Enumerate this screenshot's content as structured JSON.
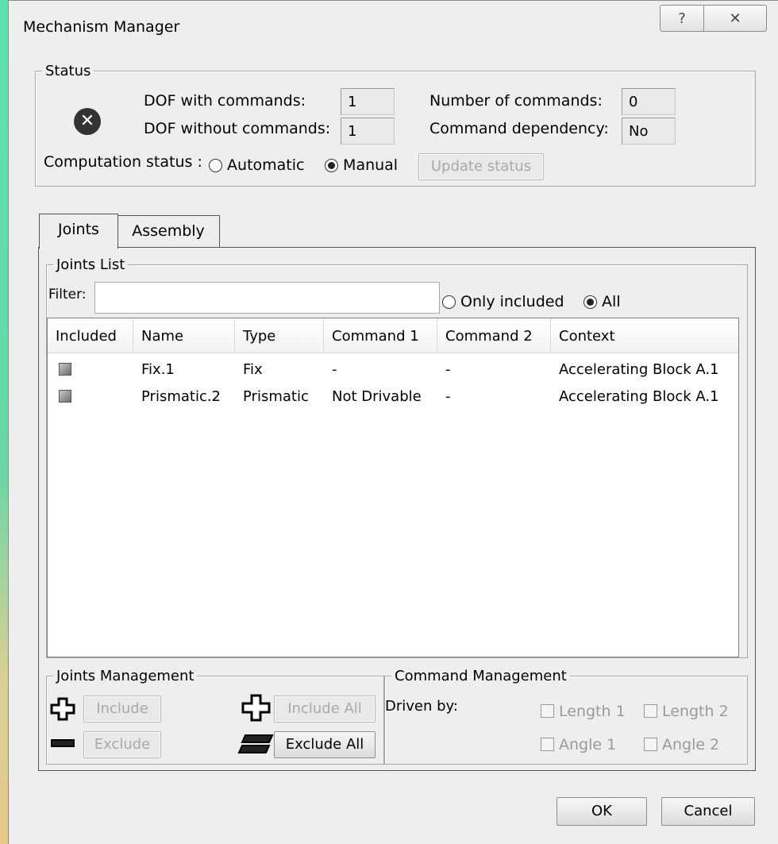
{
  "window": {
    "title": "Mechanism Manager",
    "help_glyph": "?",
    "close_glyph": "✕"
  },
  "status": {
    "legend": "Status",
    "icon": "error-x-icon",
    "dof_with_label": "DOF with commands:",
    "dof_with_value": "1",
    "dof_without_label": "DOF without commands:",
    "dof_without_value": "1",
    "num_commands_label": "Number of commands:",
    "num_commands_value": "0",
    "dependency_label": "Command dependency:",
    "dependency_value": "No",
    "computation_label": "Computation status :",
    "automatic_label": "Automatic",
    "manual_label": "Manual",
    "selected_mode": "Manual",
    "update_button": "Update status"
  },
  "tabs": [
    {
      "label": "Joints",
      "active": true
    },
    {
      "label": "Assembly",
      "active": false
    }
  ],
  "joints_list": {
    "legend": "Joints List",
    "filter_label": "Filter:",
    "filter_value": "",
    "only_included_label": "Only included",
    "all_label": "All",
    "selected_filter": "All",
    "columns": [
      "Included",
      "Name",
      "Type",
      "Command 1",
      "Command 2",
      "Context"
    ],
    "rows": [
      {
        "included": true,
        "name": "Fix.1",
        "type": "Fix",
        "command1": "-",
        "command2": "-",
        "context": "Accelerating Block A.1"
      },
      {
        "included": true,
        "name": "Prismatic.2",
        "type": "Prismatic",
        "command1": "Not Drivable",
        "command2": "-",
        "context": "Accelerating Block A.1"
      }
    ]
  },
  "joints_management": {
    "legend": "Joints Management",
    "include_label": "Include",
    "exclude_label": "Exclude",
    "include_all_label": "Include All",
    "exclude_all_label": "Exclude All"
  },
  "command_management": {
    "legend": "Command Management",
    "driven_by_label": "Driven by:",
    "length1_label": "Length 1",
    "length2_label": "Length 2",
    "angle1_label": "Angle 1",
    "angle2_label": "Angle 2"
  },
  "footer": {
    "ok_label": "OK",
    "cancel_label": "Cancel"
  }
}
